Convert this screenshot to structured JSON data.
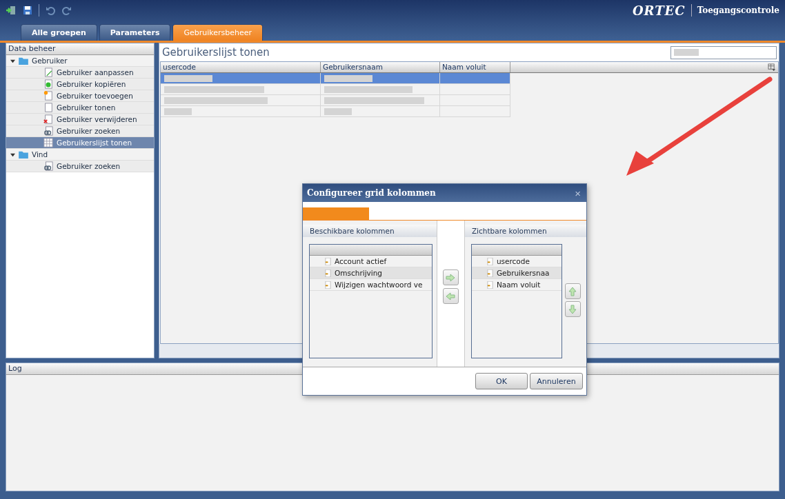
{
  "brand": {
    "logo": "ORTEC",
    "app": "Toegangscontrole"
  },
  "tabs": [
    {
      "label": "Alle groepen",
      "selected": false
    },
    {
      "label": "Parameters",
      "selected": false
    },
    {
      "label": "Gebruikersbeheer",
      "selected": true
    }
  ],
  "sidebar": {
    "title": "Data beheer",
    "items": [
      {
        "label": "Gebruiker",
        "kind": "folder",
        "expanded": true,
        "selected": false,
        "children": [
          {
            "label": "Gebruiker aanpassen",
            "kind": "edit",
            "selected": false
          },
          {
            "label": "Gebruiker kopiëren",
            "kind": "copy",
            "selected": false
          },
          {
            "label": "Gebruiker toevoegen",
            "kind": "add",
            "selected": false
          },
          {
            "label": "Gebruiker tonen",
            "kind": "show",
            "selected": false
          },
          {
            "label": "Gebruiker verwijderen",
            "kind": "delete",
            "selected": false
          },
          {
            "label": "Gebruiker zoeken",
            "kind": "search",
            "selected": false
          },
          {
            "label": "Gebruikerslijst tonen",
            "kind": "grid",
            "selected": true
          }
        ]
      },
      {
        "label": "Vind",
        "kind": "folder",
        "expanded": true,
        "selected": false,
        "children": [
          {
            "label": "Gebruiker zoeken",
            "kind": "search",
            "selected": false
          }
        ]
      }
    ]
  },
  "content": {
    "title": "Gebruikerslijst tonen",
    "table": {
      "columns": [
        "usercode",
        "Gebruikersnaam",
        "Naam voluit"
      ],
      "rows": [
        {
          "selected": true
        },
        {
          "selected": false
        },
        {
          "selected": false
        },
        {
          "selected": false
        }
      ]
    }
  },
  "log": {
    "title": "Log"
  },
  "dialog": {
    "title": "Configureer grid kolommen",
    "close": "×",
    "available": {
      "title": "Beschikbare kolommen",
      "items": [
        {
          "label": "Account actief",
          "selected": false
        },
        {
          "label": "Omschrijving",
          "selected": true
        },
        {
          "label": "Wijzigen wachtwoord ve",
          "selected": false
        }
      ]
    },
    "visible": {
      "title": "Zichtbare kolommen",
      "items": [
        {
          "label": "usercode",
          "selected": false
        },
        {
          "label": "Gebruikersnaa",
          "selected": true
        },
        {
          "label": "Naam voluit",
          "selected": false
        }
      ]
    },
    "buttons": [
      "OK",
      "Annuleren"
    ]
  }
}
